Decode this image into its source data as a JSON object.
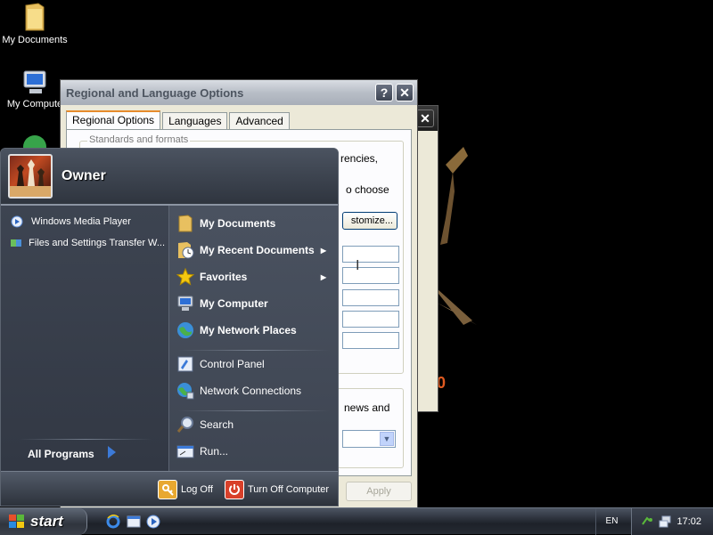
{
  "desktop": {
    "icons": [
      {
        "label": "My Documents",
        "icon": "folder-icon"
      },
      {
        "label": "My Compute",
        "icon": "computer-icon"
      },
      {
        "label": "",
        "icon": "network-globe-icon"
      }
    ]
  },
  "dialog": {
    "title": "Regional and Language Options",
    "help_label": "?",
    "close_label": "✕",
    "tabs": [
      {
        "label": "Regional Options",
        "active": true
      },
      {
        "label": "Languages",
        "active": false
      },
      {
        "label": "Advanced",
        "active": false
      }
    ],
    "group_title": "Standards and formats",
    "partial_texts": [
      "rencies,",
      "o choose"
    ],
    "customize_label": "stomize...",
    "location_partial": "news and",
    "apply_label": "Apply"
  },
  "back_window": {
    "close_label": "✕"
  },
  "start_menu": {
    "user": "Owner",
    "pinned": [
      {
        "label": "Windows Media Player",
        "icon": "media-player-icon"
      },
      {
        "label": "Files and Settings Transfer W...",
        "icon": "transfer-wizard-icon"
      }
    ],
    "all_programs": "All Programs",
    "places": [
      {
        "label": "My Documents",
        "icon": "folder-icon",
        "submenu": false
      },
      {
        "label": "My Recent Documents",
        "icon": "recent-docs-icon",
        "submenu": true
      },
      {
        "label": "Favorites",
        "icon": "star-icon",
        "submenu": true
      },
      {
        "label": "My Computer",
        "icon": "computer-icon",
        "submenu": false
      },
      {
        "label": "My Network Places",
        "icon": "network-globe-icon",
        "submenu": false
      }
    ],
    "system": [
      {
        "label": "Control Panel",
        "icon": "control-panel-icon"
      },
      {
        "label": "Network Connections",
        "icon": "network-connections-icon"
      }
    ],
    "tools": [
      {
        "label": "Search",
        "icon": "search-icon"
      },
      {
        "label": "Run...",
        "icon": "run-icon"
      }
    ],
    "log_off": "Log Off",
    "turn_off": "Turn Off Computer"
  },
  "taskbar": {
    "start_label": "start",
    "quicklaunch": [
      "internet-explorer-icon",
      "show-desktop-icon",
      "media-player-icon"
    ],
    "language": "EN",
    "clock": "17:02"
  },
  "colors": {
    "start_menu_bg": "#3a404a",
    "dialog_bg": "#ece9d8",
    "tab_accent": "#e68b2c"
  }
}
